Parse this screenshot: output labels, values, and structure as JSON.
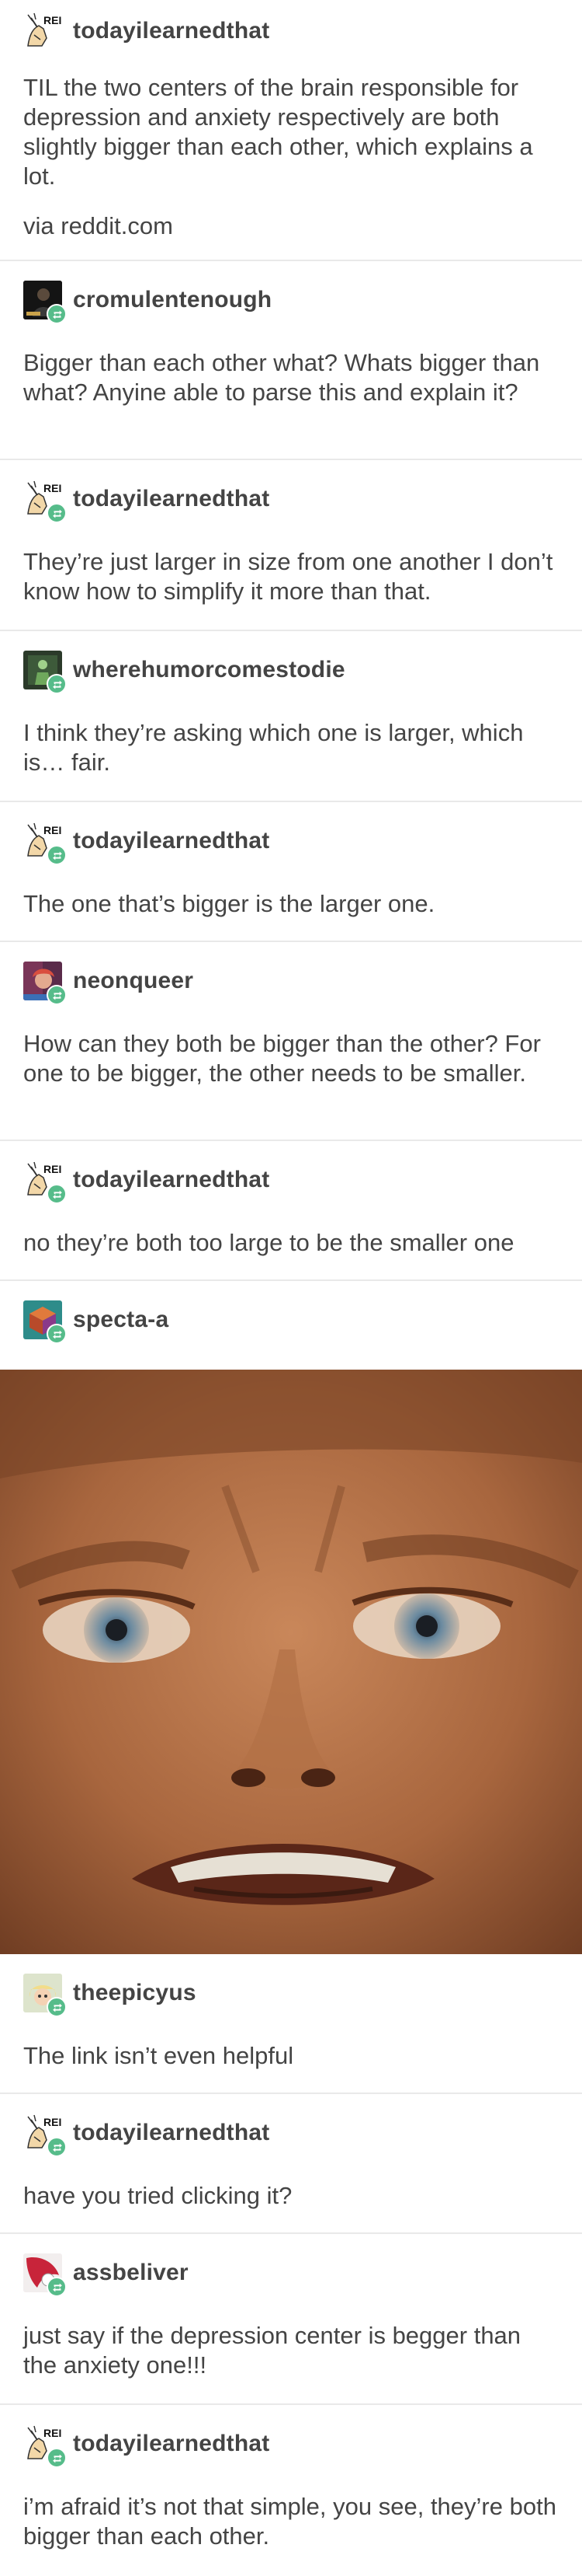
{
  "thread": {
    "op": {
      "username": "todayilearnedthat",
      "text": "TIL the two centers of the brain responsible for depression and anxiety respectively are both slightly bigger than each other, which explains a lot.",
      "source": "via reddit.com"
    },
    "reblogs": [
      {
        "username": "cromulentenough",
        "avatar": "dark-silhouette-avatar",
        "text": "Bigger than each other what? Whats bigger than what? Anyine able to parse this and explain it?"
      },
      {
        "username": "todayilearnedthat",
        "avatar": "til-sketch-avatar",
        "text": "They’re just larger in size from one another I don’t know how to simplify it more than that."
      },
      {
        "username": "wherehumorcomestodie",
        "avatar": "green-figure-avatar",
        "text": "I think they’re asking which one is larger, which is… fair."
      },
      {
        "username": "todayilearnedthat",
        "avatar": "til-sketch-avatar",
        "text": "The one that’s bigger is the larger one."
      },
      {
        "username": "neonqueer",
        "avatar": "colorful-portrait-avatar",
        "text": "How can they both be bigger than the other? For one to be bigger, the other needs to be smaller."
      },
      {
        "username": "todayilearnedthat",
        "avatar": "til-sketch-avatar",
        "text": "no they’re both too large to be the smaller one"
      },
      {
        "username": "specta-a",
        "avatar": "cube-avatar",
        "image": "confused-face-closeup"
      },
      {
        "username": "theepicyus",
        "avatar": "cartoon-blonde-avatar",
        "text": "The link isn’t even helpful"
      },
      {
        "username": "todayilearnedthat",
        "avatar": "til-sketch-avatar",
        "text": "have you tried clicking it?"
      },
      {
        "username": "assbeliver",
        "avatar": "red-white-avatar",
        "text": "just say if the depression center is begger than the anxiety one!!!"
      },
      {
        "username": "todayilearnedthat",
        "avatar": "til-sketch-avatar",
        "text": "i’m afraid it’s not that simple, you see, they’re both bigger than each other."
      }
    ]
  },
  "colors": {
    "reblog_badge": "#56bc8a",
    "divider": "#e9e9e9",
    "text": "#444444"
  },
  "icons": {
    "reblog": "reblog-icon",
    "til_avatar_text": "REI"
  }
}
